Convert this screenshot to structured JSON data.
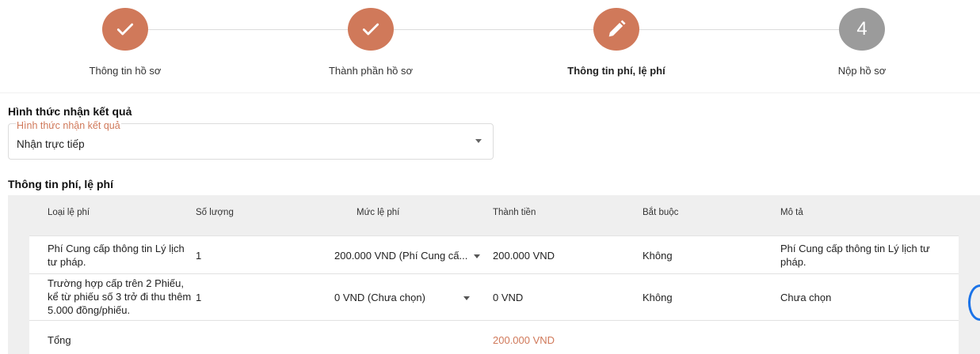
{
  "stepper": {
    "steps": [
      {
        "label": "Thông tin hồ sơ",
        "status": "done",
        "icon": "check-icon"
      },
      {
        "label": "Thành phần hồ sơ",
        "status": "done",
        "icon": "check-icon"
      },
      {
        "label": "Thông tin phí, lệ phí",
        "status": "active",
        "icon": "pencil-icon"
      },
      {
        "label": "Nộp hồ sơ",
        "status": "todo",
        "number": "4"
      }
    ]
  },
  "receive": {
    "section_title": "Hình thức nhận kết quả",
    "field_label": "Hình thức nhận kết quả",
    "value": "Nhận trực tiếp"
  },
  "fees": {
    "section_title": "Thông tin phí, lệ phí",
    "headers": [
      "Loại lệ phí",
      "Số lượng",
      "Mức lệ phí",
      "Thành tiền",
      "Bắt buộc",
      "Mô tả"
    ],
    "rows": [
      {
        "type": "Phí Cung cấp thông tin Lý lịch tư pháp.",
        "quantity": "1",
        "fee_level": "200.000 VND (Phí Cung cấ...",
        "amount": "200.000 VND",
        "required": "Không",
        "description": "Phí Cung cấp thông tin Lý lịch tư pháp."
      },
      {
        "type": "Trường hợp cấp trên 2 Phiếu, kể từ phiếu số 3 trở đi thu thêm 5.000 đồng/phiếu.",
        "quantity": "1",
        "fee_level": "0 VND (Chưa chọn)",
        "amount": "0 VND",
        "required": "Không",
        "description": "Chưa chọn"
      }
    ],
    "total_label": "Tổng",
    "total_value": "200.000 VND"
  },
  "colors": {
    "accent": "#d0795a",
    "pending": "#9b9b9b",
    "edge_button": "#1a73e8"
  }
}
